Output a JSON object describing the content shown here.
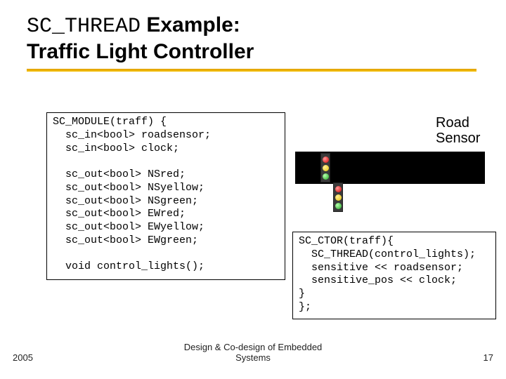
{
  "title": {
    "mono_part": "SC_THREAD",
    "bold_part_line1": " Example:",
    "line2": "Traffic Light Controller"
  },
  "code_box": "SC_MODULE(traff) {\n  sc_in<bool> roadsensor;\n  sc_in<bool> clock;\n\n  sc_out<bool> NSred;\n  sc_out<bool> NSyellow;\n  sc_out<bool> NSgreen;\n  sc_out<bool> EWred;\n  sc_out<bool> EWyellow;\n  sc_out<bool> EWgreen;\n\n  void control_lights();",
  "ctor_box": "SC_CTOR(traff){\n  SC_THREAD(control_lights);\n  sensitive << roadsensor;\n  sensitive_pos << clock;\n}\n};",
  "road_label": "Road\nSensor",
  "footer": {
    "center": "Design & Co-design of Embedded\nSystems",
    "year": "2005",
    "page": "17"
  }
}
